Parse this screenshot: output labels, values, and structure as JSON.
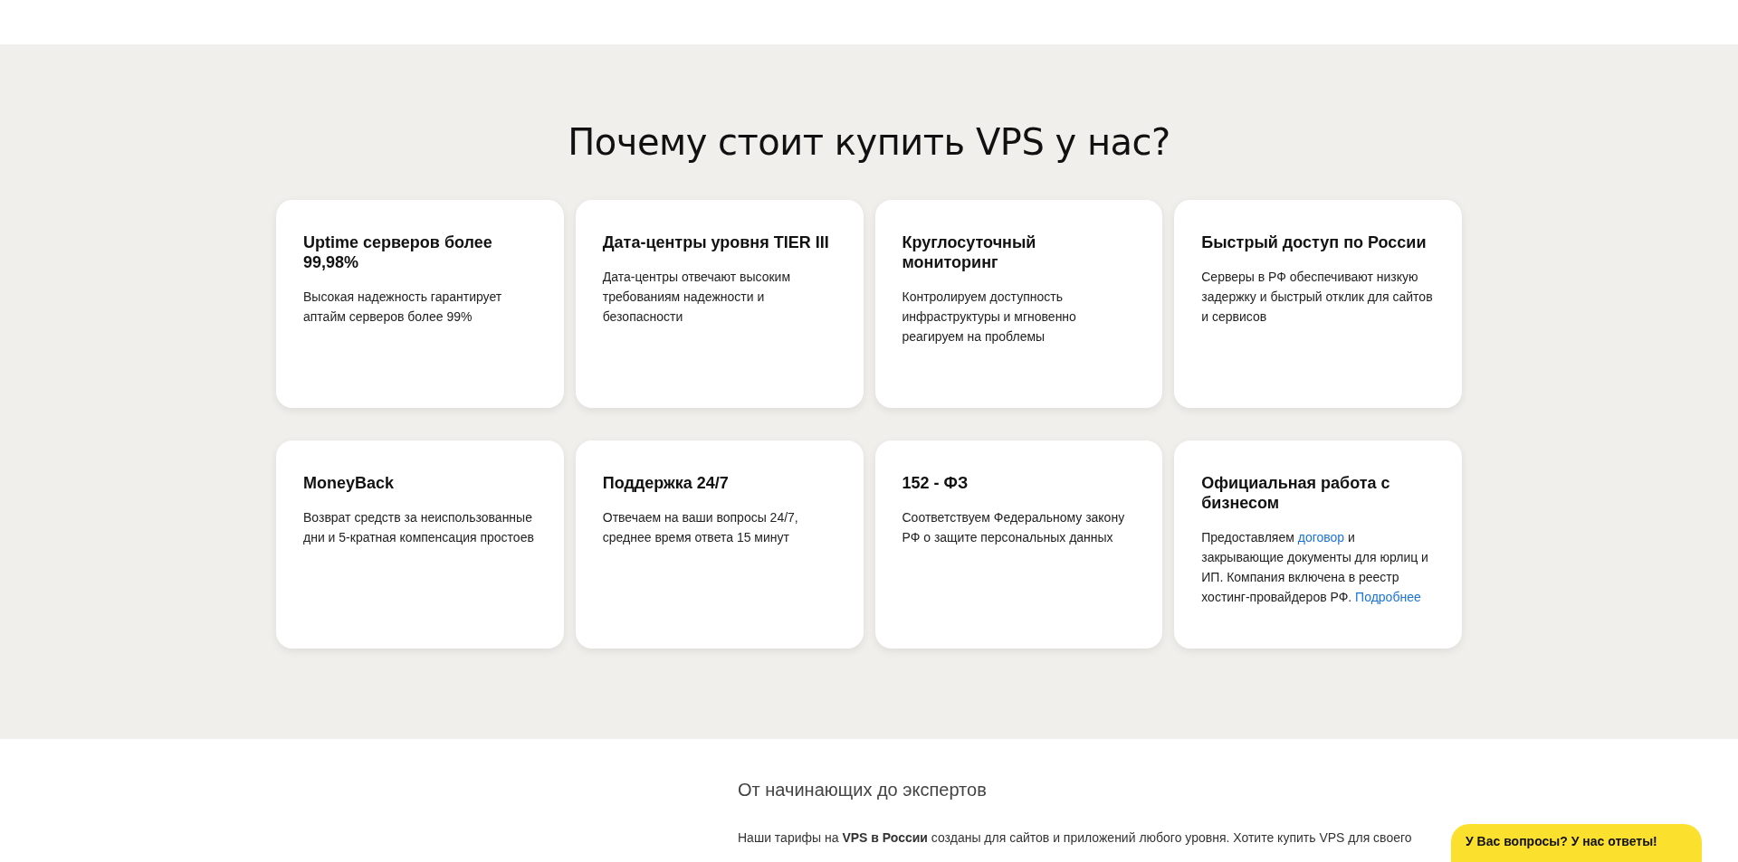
{
  "heading": "Почему стоит купить VPS у нас?",
  "cards": [
    {
      "title": "Uptime серверов более 99,98%",
      "body": [
        {
          "kind": "text",
          "text": "Высокая надежность гарантирует аптайм серверов более 99%"
        }
      ]
    },
    {
      "title": "Дата-центры уровня TIER III",
      "body": [
        {
          "kind": "text",
          "text": "Дата-центры отвечают высоким требованиям надежности и безопасности"
        }
      ]
    },
    {
      "title": "Круглосуточный мониторинг",
      "body": [
        {
          "kind": "text",
          "text": "Контролируем доступность инфраструктуры и мгновенно реагируем на проблемы"
        }
      ]
    },
    {
      "title": "Быстрый доступ по России",
      "body": [
        {
          "kind": "text",
          "text": "Серверы в РФ обеспечивают низкую задержку и быстрый отклик для сайтов и сервисов"
        }
      ]
    },
    {
      "title": "MoneyBack",
      "body": [
        {
          "kind": "text",
          "text": "Возврат средств за неиспользованные дни и 5-кратная компенсация простоев"
        }
      ]
    },
    {
      "title": "Поддержка 24/7",
      "body": [
        {
          "kind": "text",
          "text": "Отвечаем на ваши вопросы 24/7, среднее время ответа 15 минут"
        }
      ]
    },
    {
      "title": "152 - ФЗ",
      "body": [
        {
          "kind": "text",
          "text": "Соответствуем Федеральному закону РФ о защите персональных данных"
        }
      ]
    },
    {
      "title": "Официальная работа с бизнесом",
      "body": [
        {
          "kind": "text",
          "text": "Предоставляем "
        },
        {
          "kind": "link",
          "text": "договор"
        },
        {
          "kind": "text",
          "text": " и закрывающие документы для юрлиц и ИП. Компания включена в реестр хостинг-провайдеров РФ. "
        },
        {
          "kind": "link",
          "text": "Подробнее"
        }
      ]
    }
  ],
  "about": {
    "title": "От начинающих до экспертов",
    "paragraph": "Наши тарифы на **VPS в России** созданы для сайтов и приложений любого уровня. Хотите купить VPS для своего"
  },
  "chat_button": "У Вас вопросы? У нас ответы!"
}
